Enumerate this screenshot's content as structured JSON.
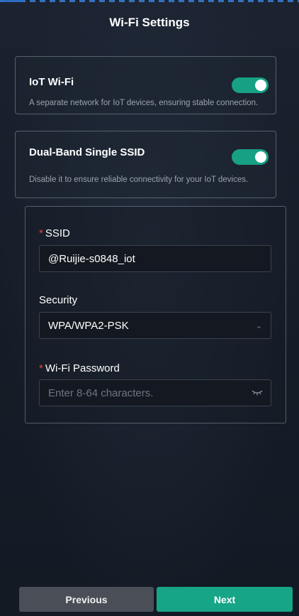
{
  "header": {
    "title": "Wi-Fi Settings"
  },
  "iot_wifi": {
    "title": "IoT Wi-Fi",
    "description": "A separate network for IoT devices, ensuring stable connection.",
    "enabled": true
  },
  "dual_band": {
    "title": "Dual-Band Single SSID",
    "description": "Disable it to ensure reliable connectivity for your IoT devices.",
    "enabled": true
  },
  "form": {
    "ssid": {
      "required_mark": "*",
      "label": "SSID",
      "value": "@Ruijie-s0848_iot"
    },
    "security": {
      "label": "Security",
      "selected": "WPA/WPA2-PSK"
    },
    "password": {
      "required_mark": "*",
      "label": "Wi-Fi Password",
      "placeholder": "Enter 8-64 characters.",
      "value": ""
    }
  },
  "footer": {
    "previous_label": "Previous",
    "next_label": "Next"
  },
  "colors": {
    "accent": "#17a587",
    "required": "#e0473e",
    "background": "#171d28"
  }
}
